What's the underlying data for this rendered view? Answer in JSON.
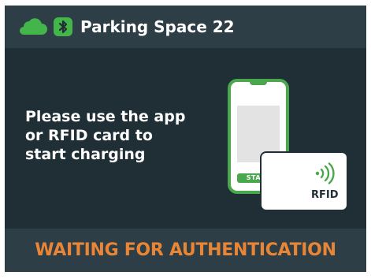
{
  "header": {
    "title": "Parking Space 22",
    "cloud_icon": "cloud-icon",
    "bluetooth_icon": "bluetooth-icon"
  },
  "main": {
    "instruction_lines": [
      "Please use the app",
      "or RFID card to",
      "start charging"
    ],
    "phone": {
      "start_label": "START"
    },
    "card": {
      "label": "RFID",
      "icon": "contactless-icon"
    }
  },
  "status": {
    "text": "WAITING FOR AUTHENTICATION"
  },
  "colors": {
    "background": "#1f2f35",
    "bars": "#2d3e46",
    "accent_green": "#4aa84c",
    "status_orange": "#e98536",
    "text": "#ffffff"
  }
}
